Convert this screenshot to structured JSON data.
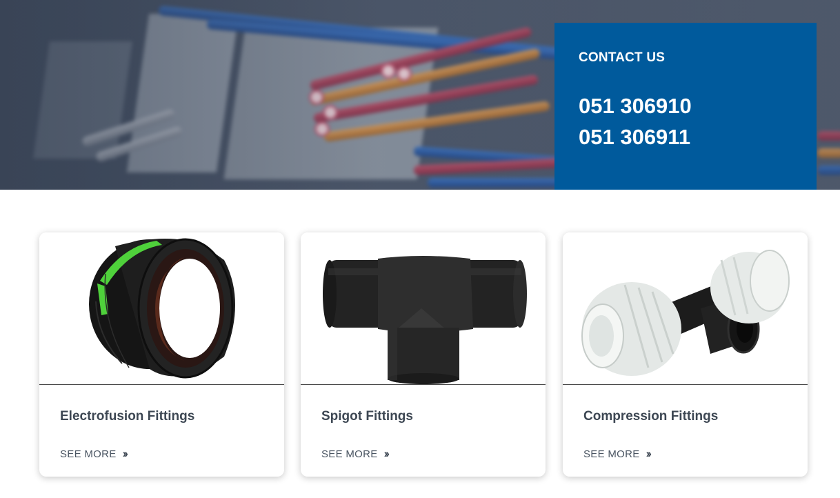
{
  "contact": {
    "title": "CONTACT US",
    "phones": [
      "051 306910",
      "051 306911"
    ],
    "bg_color": "#005a9c"
  },
  "products": [
    {
      "title": "Electrofusion Fittings",
      "link_label": "SEE MORE",
      "link_icon": "double-chevron-right-icon"
    },
    {
      "title": "Spigot Fittings",
      "link_label": "SEE MORE",
      "link_icon": "double-chevron-right-icon"
    },
    {
      "title": "Compression Fittings",
      "link_label": "SEE MORE",
      "link_icon": "double-chevron-right-icon"
    }
  ],
  "colors": {
    "card_title": "#3d4753",
    "accent_green": "#4fd13b"
  }
}
